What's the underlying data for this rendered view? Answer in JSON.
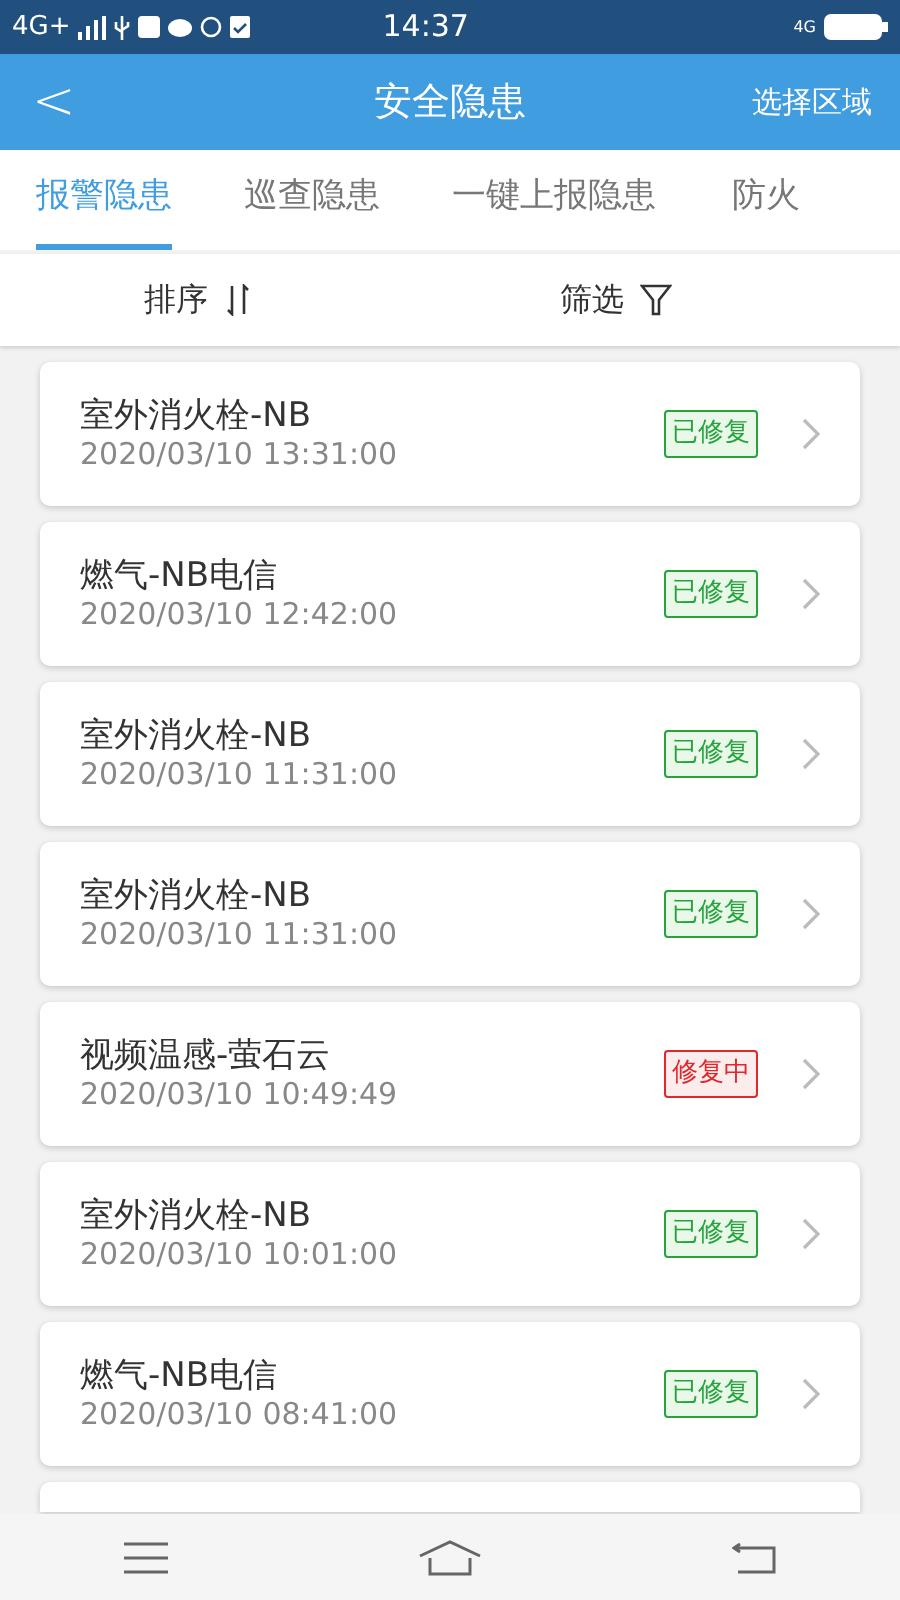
{
  "status_bar": {
    "network": "4G+",
    "time": "14:37",
    "network_right": "4G"
  },
  "header": {
    "back": "<",
    "title": "安全隐患",
    "action": "选择区域"
  },
  "tabs": [
    {
      "label": "报警隐患",
      "selected": true
    },
    {
      "label": "巡查隐患",
      "selected": false
    },
    {
      "label": "一键上报隐患",
      "selected": false
    },
    {
      "label": "防火",
      "selected": false
    }
  ],
  "toolbar": {
    "sort": "排序",
    "filter": "筛选"
  },
  "items": [
    {
      "name": "室外消火栓-NB",
      "time": "2020/03/10 13:31:00",
      "status": "已修复",
      "kind": "fixed"
    },
    {
      "name": "燃气-NB电信",
      "time": "2020/03/10 12:42:00",
      "status": "已修复",
      "kind": "fixed"
    },
    {
      "name": "室外消火栓-NB",
      "time": "2020/03/10 11:31:00",
      "status": "已修复",
      "kind": "fixed"
    },
    {
      "name": "室外消火栓-NB",
      "time": "2020/03/10 11:31:00",
      "status": "已修复",
      "kind": "fixed"
    },
    {
      "name": "视频温感-萤石云",
      "time": "2020/03/10 10:49:49",
      "status": "修复中",
      "kind": "repairing"
    },
    {
      "name": "室外消火栓-NB",
      "time": "2020/03/10 10:01:00",
      "status": "已修复",
      "kind": "fixed"
    },
    {
      "name": "燃气-NB电信",
      "time": "2020/03/10 08:41:00",
      "status": "已修复",
      "kind": "fixed"
    }
  ]
}
